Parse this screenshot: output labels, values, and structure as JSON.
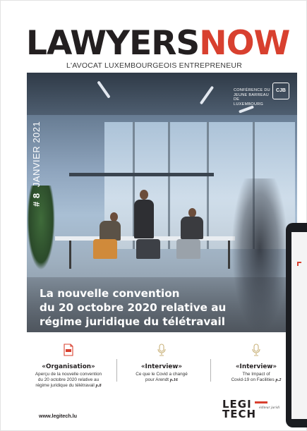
{
  "masthead": {
    "brand_part1": "LAWYERS",
    "brand_part2": "NOW",
    "tagline": "L'AVOCAT LUXEMBOURGEOIS ENTREPRENEUR",
    "colors": {
      "dark": "#231f20",
      "accent": "#d8402f"
    }
  },
  "cover": {
    "issue_number": "# 8",
    "issue_date": "JANVIER 2021",
    "publisher_lines": [
      "CONFÉRENCE DU",
      "JEUNE BARREAU",
      "DE LUXEMBOURG"
    ],
    "publisher_logo_text": "CJB",
    "headline_lines": [
      "La nouvelle convention",
      "du 20 octobre 2020 relative au",
      "régime juridique du télétravail"
    ]
  },
  "features": [
    {
      "icon": "pdf-document-icon",
      "title": "«Organisation»",
      "desc_lines": [
        "Aperçu de la nouvelle convention",
        "du 20 octobre 2020 relative au",
        "régime juridique du télétravail"
      ],
      "page": "p.8"
    },
    {
      "icon": "microphone-icon",
      "title": "«Interview»",
      "desc_lines": [
        "Ce que le Covid a changé",
        "pour Arendt"
      ],
      "page": "p.16"
    },
    {
      "icon": "microphone-icon",
      "title": "«Interview»",
      "desc_lines": [
        "The Impact of",
        "Covid-19 on Facilities"
      ],
      "page": "p.2"
    }
  ],
  "footer": {
    "website": "www.legitech.lu",
    "brand_line1": "LEGI",
    "brand_line2": "TECH",
    "brand_sub": "éditeur juridi"
  }
}
